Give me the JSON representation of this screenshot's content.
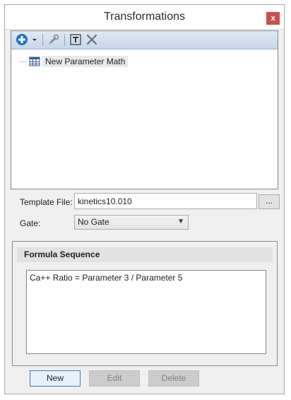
{
  "window": {
    "title": "Transformations",
    "close_label": "x"
  },
  "toolbar": {
    "add_icon": "plus-circle-icon",
    "dropdown_icon": "chevron-down-icon",
    "edit_icon": "wrench-icon",
    "rename_icon": "text-cursor-icon",
    "delete_icon": "x-icon"
  },
  "tree": {
    "items": [
      {
        "label": "New Parameter Math",
        "icon": "grid-table-icon"
      }
    ]
  },
  "template": {
    "label": "Template File:",
    "value": "kinetics10.010",
    "browse_label": "..."
  },
  "gate": {
    "label": "Gate:",
    "selected": "No Gate"
  },
  "formula": {
    "header": "Formula Sequence",
    "items": [
      "Ca++ Ratio = Parameter 3 / Parameter 5"
    ]
  },
  "buttons": {
    "new": "New",
    "edit": "Edit",
    "delete": "Delete"
  },
  "colors": {
    "accent": "#1e73be",
    "close": "#c75050",
    "toolbar": "#d3e0f0"
  }
}
